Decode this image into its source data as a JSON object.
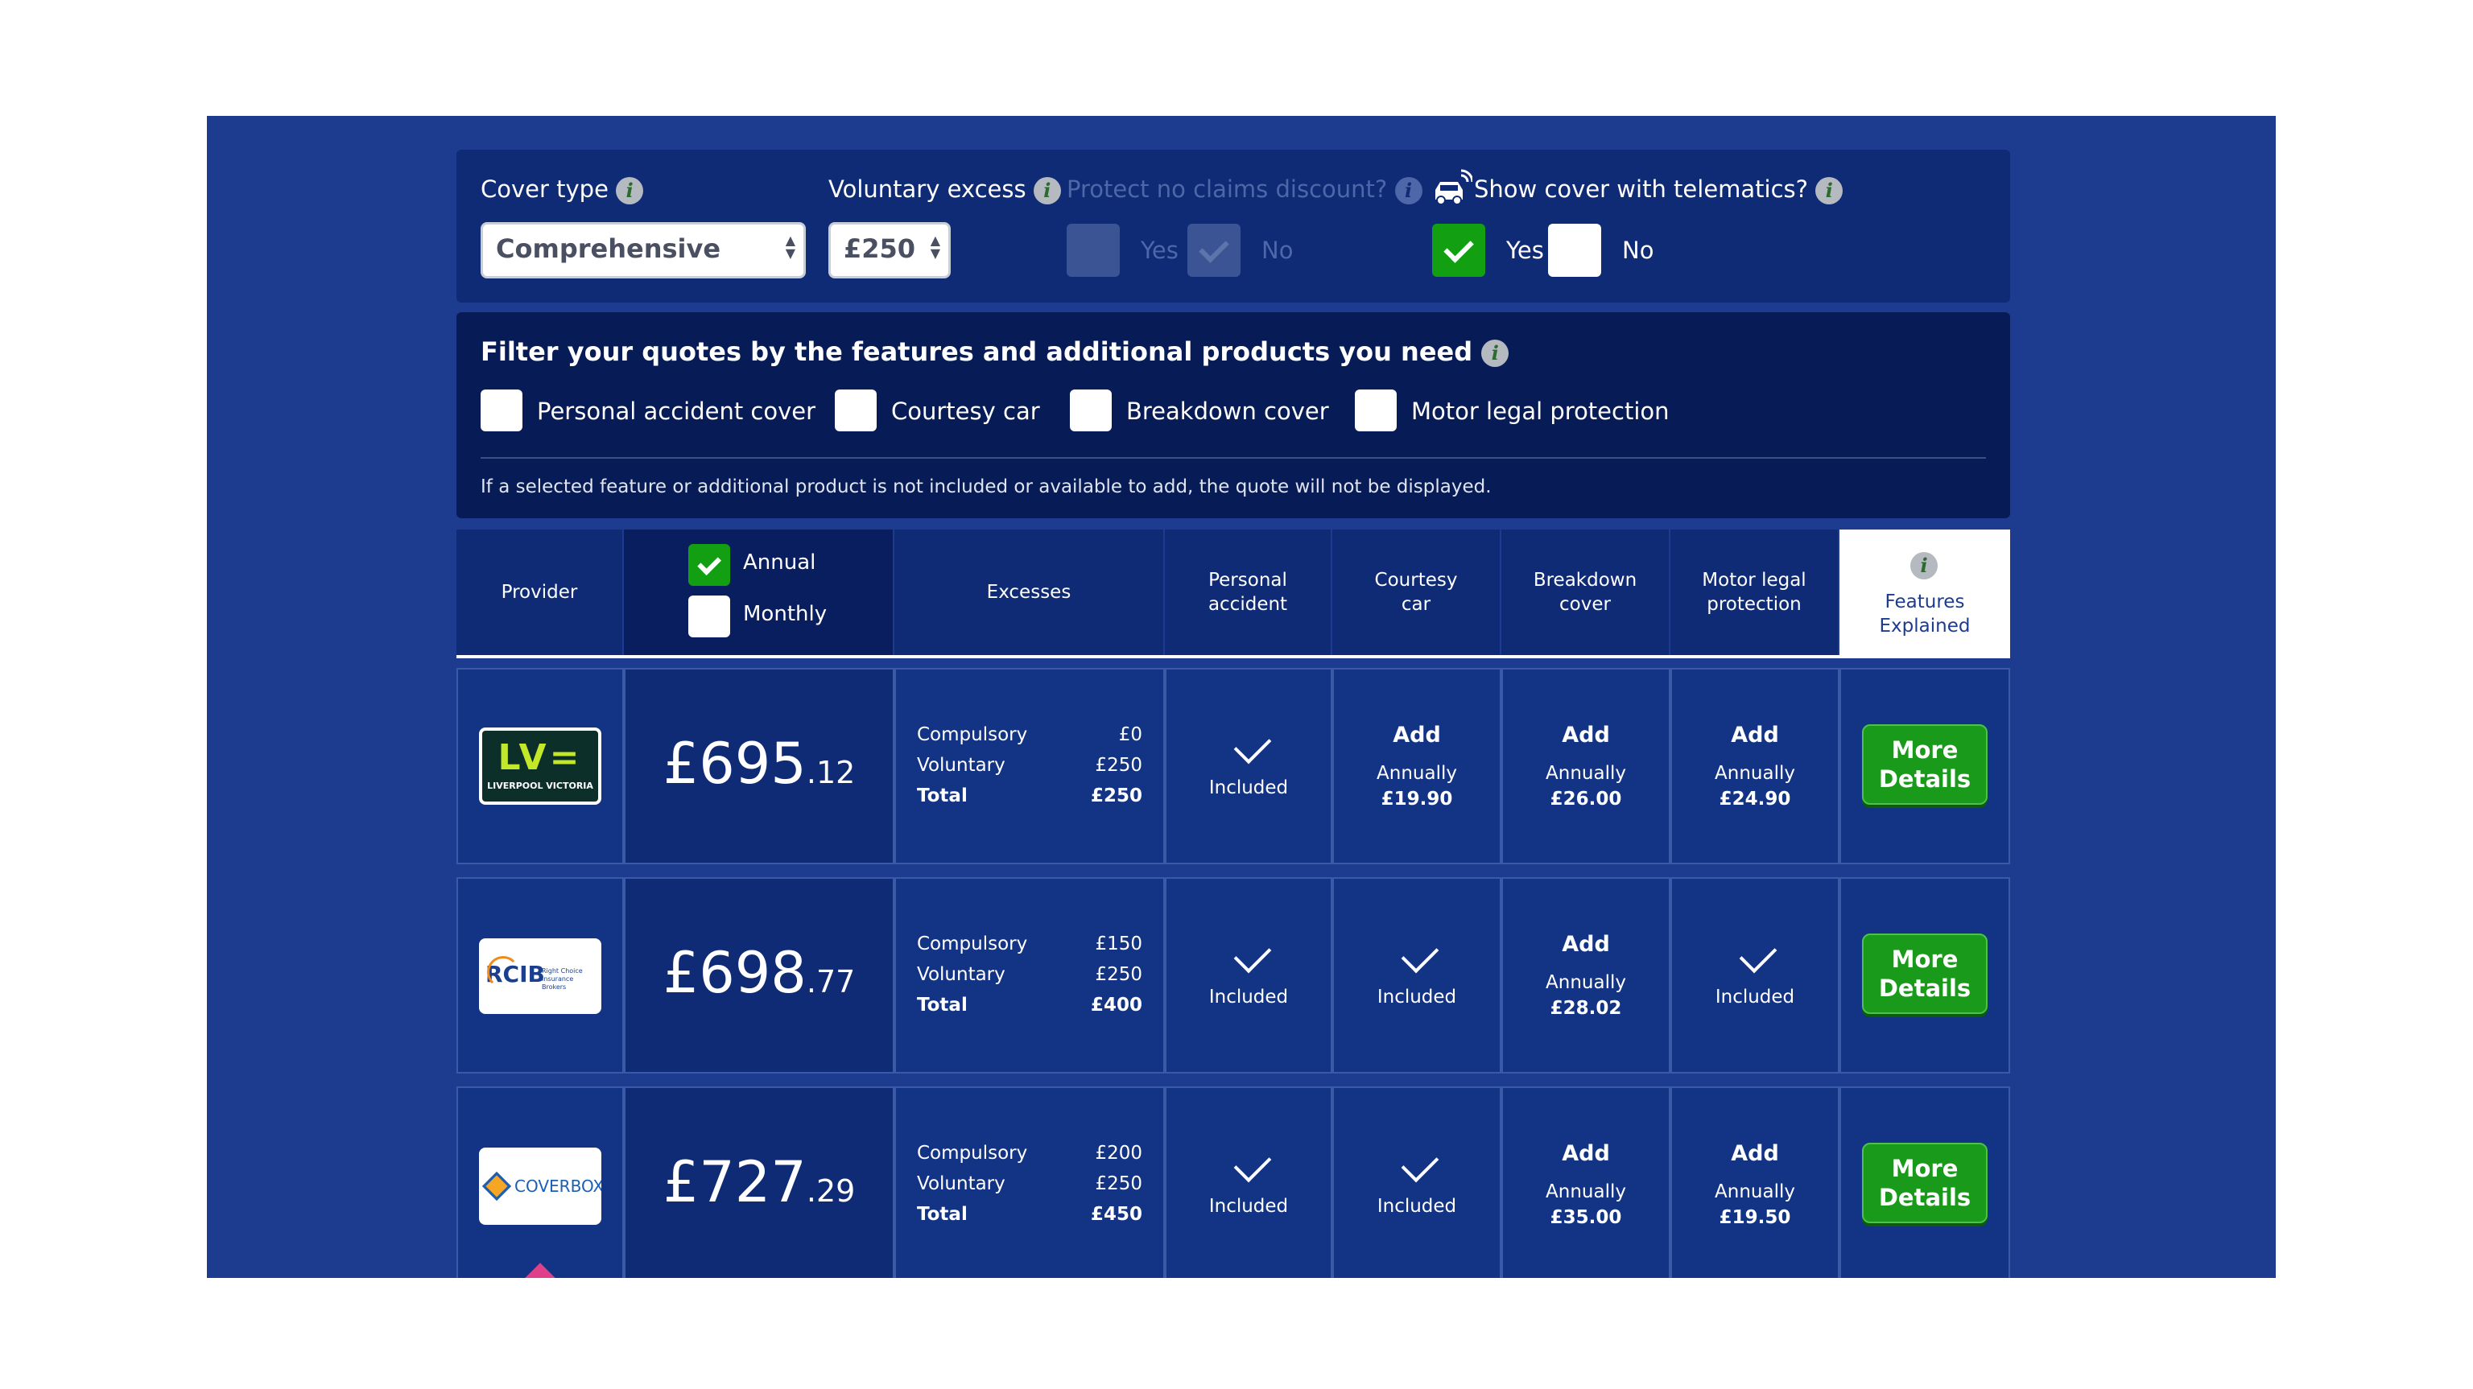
{
  "filters": {
    "cover_type_label": "Cover type",
    "cover_type_value": "Comprehensive",
    "voluntary_excess_label": "Voluntary excess",
    "voluntary_excess_value": "£250",
    "protect_ncd_label": "Protect no claims discount?",
    "protect_ncd_yes": "Yes",
    "protect_ncd_no": "No",
    "telematics_label": "Show cover with telematics?",
    "telematics_yes": "Yes",
    "telematics_no": "No"
  },
  "features_filter": {
    "title": "Filter your quotes by the features and additional products you need",
    "options": [
      "Personal accident cover",
      "Courtesy car",
      "Breakdown cover",
      "Motor legal protection"
    ],
    "note": "If a selected feature or additional product is not included or available to add, the quote will not be displayed."
  },
  "table_header": {
    "provider": "Provider",
    "annual": "Annual",
    "monthly": "Monthly",
    "excesses": "Excesses",
    "personal_accident": "Personal accident",
    "courtesy_car": "Courtesy car",
    "breakdown_cover": "Breakdown cover",
    "motor_legal": "Motor legal protection",
    "features_explained": "Features Explained"
  },
  "labels": {
    "compulsory": "Compulsory",
    "voluntary": "Voluntary",
    "total": "Total",
    "included": "Included",
    "add": "Add",
    "annually": "Annually",
    "more_details": "More Details"
  },
  "quotes": [
    {
      "provider_logo_text": "LV=",
      "provider_logo_sub": "LIVERPOOL VICTORIA",
      "price_main": "£695",
      "price_cents": ".12",
      "compulsory": "£0",
      "voluntary": "£250",
      "total": "£250",
      "personal_accident": "Included",
      "courtesy_car": "£19.90",
      "breakdown_cover": "£26.00",
      "motor_legal": "£24.90"
    },
    {
      "provider_logo_text": "RCIB",
      "provider_logo_sub": "Right Choice Insurance Brokers",
      "price_main": "£698",
      "price_cents": ".77",
      "compulsory": "£150",
      "voluntary": "£250",
      "total": "£400",
      "personal_accident": "Included",
      "courtesy_car": "Included",
      "breakdown_cover": "£28.02",
      "motor_legal": "Included"
    },
    {
      "provider_logo_text": "COVERBOX",
      "price_main": "£727",
      "price_cents": ".29",
      "compulsory": "£200",
      "voluntary": "£250",
      "total": "£450",
      "personal_accident": "Included",
      "courtesy_car": "Included",
      "breakdown_cover": "£35.00",
      "motor_legal": "£19.50"
    }
  ],
  "colors": {
    "background": "#1d3c8f",
    "panel": "#0f2b75",
    "panel_dark": "#071c57",
    "accent_green": "#12a012"
  }
}
